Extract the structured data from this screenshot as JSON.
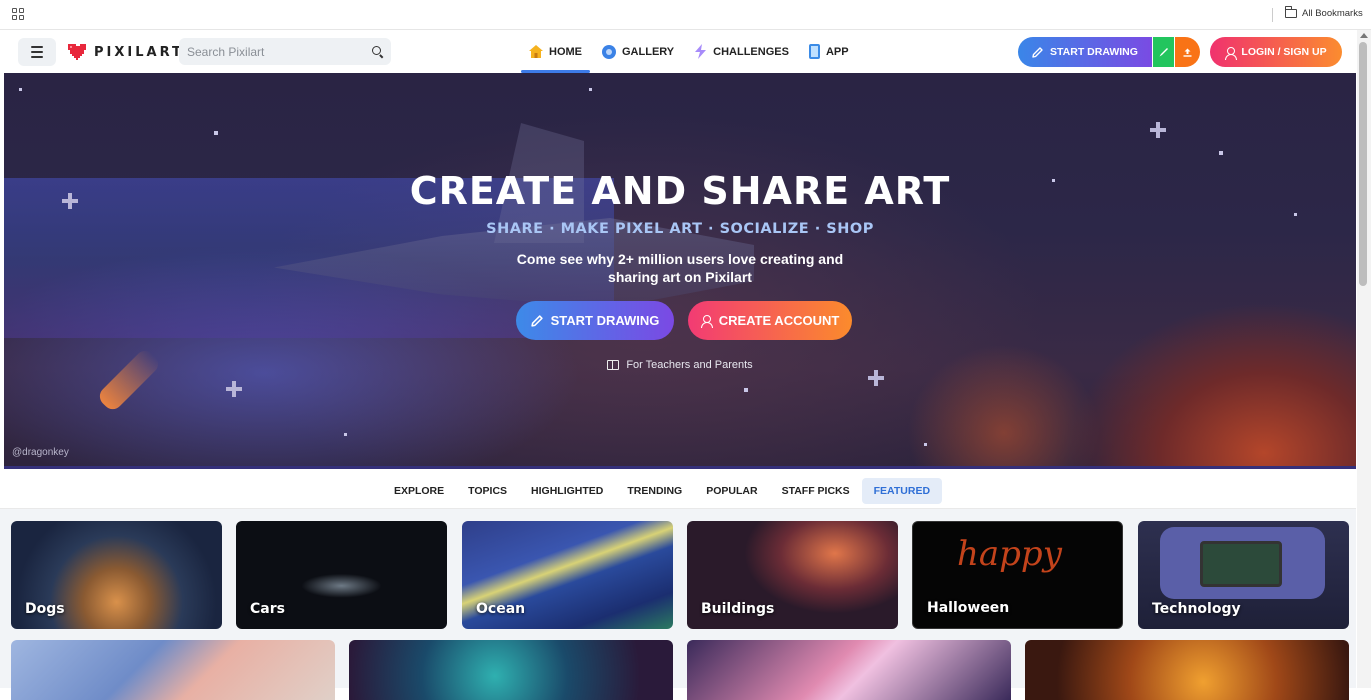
{
  "browser": {
    "bookmarks_label": "All Bookmarks"
  },
  "header": {
    "logo_text": "PIXILART",
    "search_placeholder": "Search Pixilart",
    "nav": [
      {
        "label": "HOME",
        "icon": "home-icon",
        "active": true
      },
      {
        "label": "GALLERY",
        "icon": "gallery-icon",
        "active": false
      },
      {
        "label": "CHALLENGES",
        "icon": "lightning-icon",
        "active": false
      },
      {
        "label": "APP",
        "icon": "phone-icon",
        "active": false
      }
    ],
    "start_drawing_label": "START DRAWING",
    "login_label": "LOGIN / SIGN UP"
  },
  "hero": {
    "title": "CREATE AND SHARE ART",
    "subtitle": "SHARE · MAKE PIXEL ART · SOCIALIZE · SHOP",
    "description": "Come see why 2+ million users love creating and sharing art on Pixilart",
    "start_drawing_label": "START DRAWING",
    "create_account_label": "CREATE ACCOUNT",
    "teachers_link": "For Teachers and Parents",
    "credit": "@dragonkey"
  },
  "tabs": [
    {
      "label": "EXPLORE",
      "active": false
    },
    {
      "label": "TOPICS",
      "active": false
    },
    {
      "label": "HIGHLIGHTED",
      "active": false
    },
    {
      "label": "TRENDING",
      "active": false
    },
    {
      "label": "POPULAR",
      "active": false
    },
    {
      "label": "STAFF PICKS",
      "active": false
    },
    {
      "label": "FEATURED",
      "active": true
    }
  ],
  "topics": [
    "Dogs",
    "Cars",
    "Ocean",
    "Buildings",
    "Halloween",
    "Technology"
  ],
  "halloween_art_text": "happy",
  "colors": {
    "accent_blue": "#3d7be8",
    "brand_pink": "#f0326e",
    "brand_orange": "#fb8c2f",
    "draw_green": "#22c55e",
    "upload_orange": "#f97316"
  }
}
